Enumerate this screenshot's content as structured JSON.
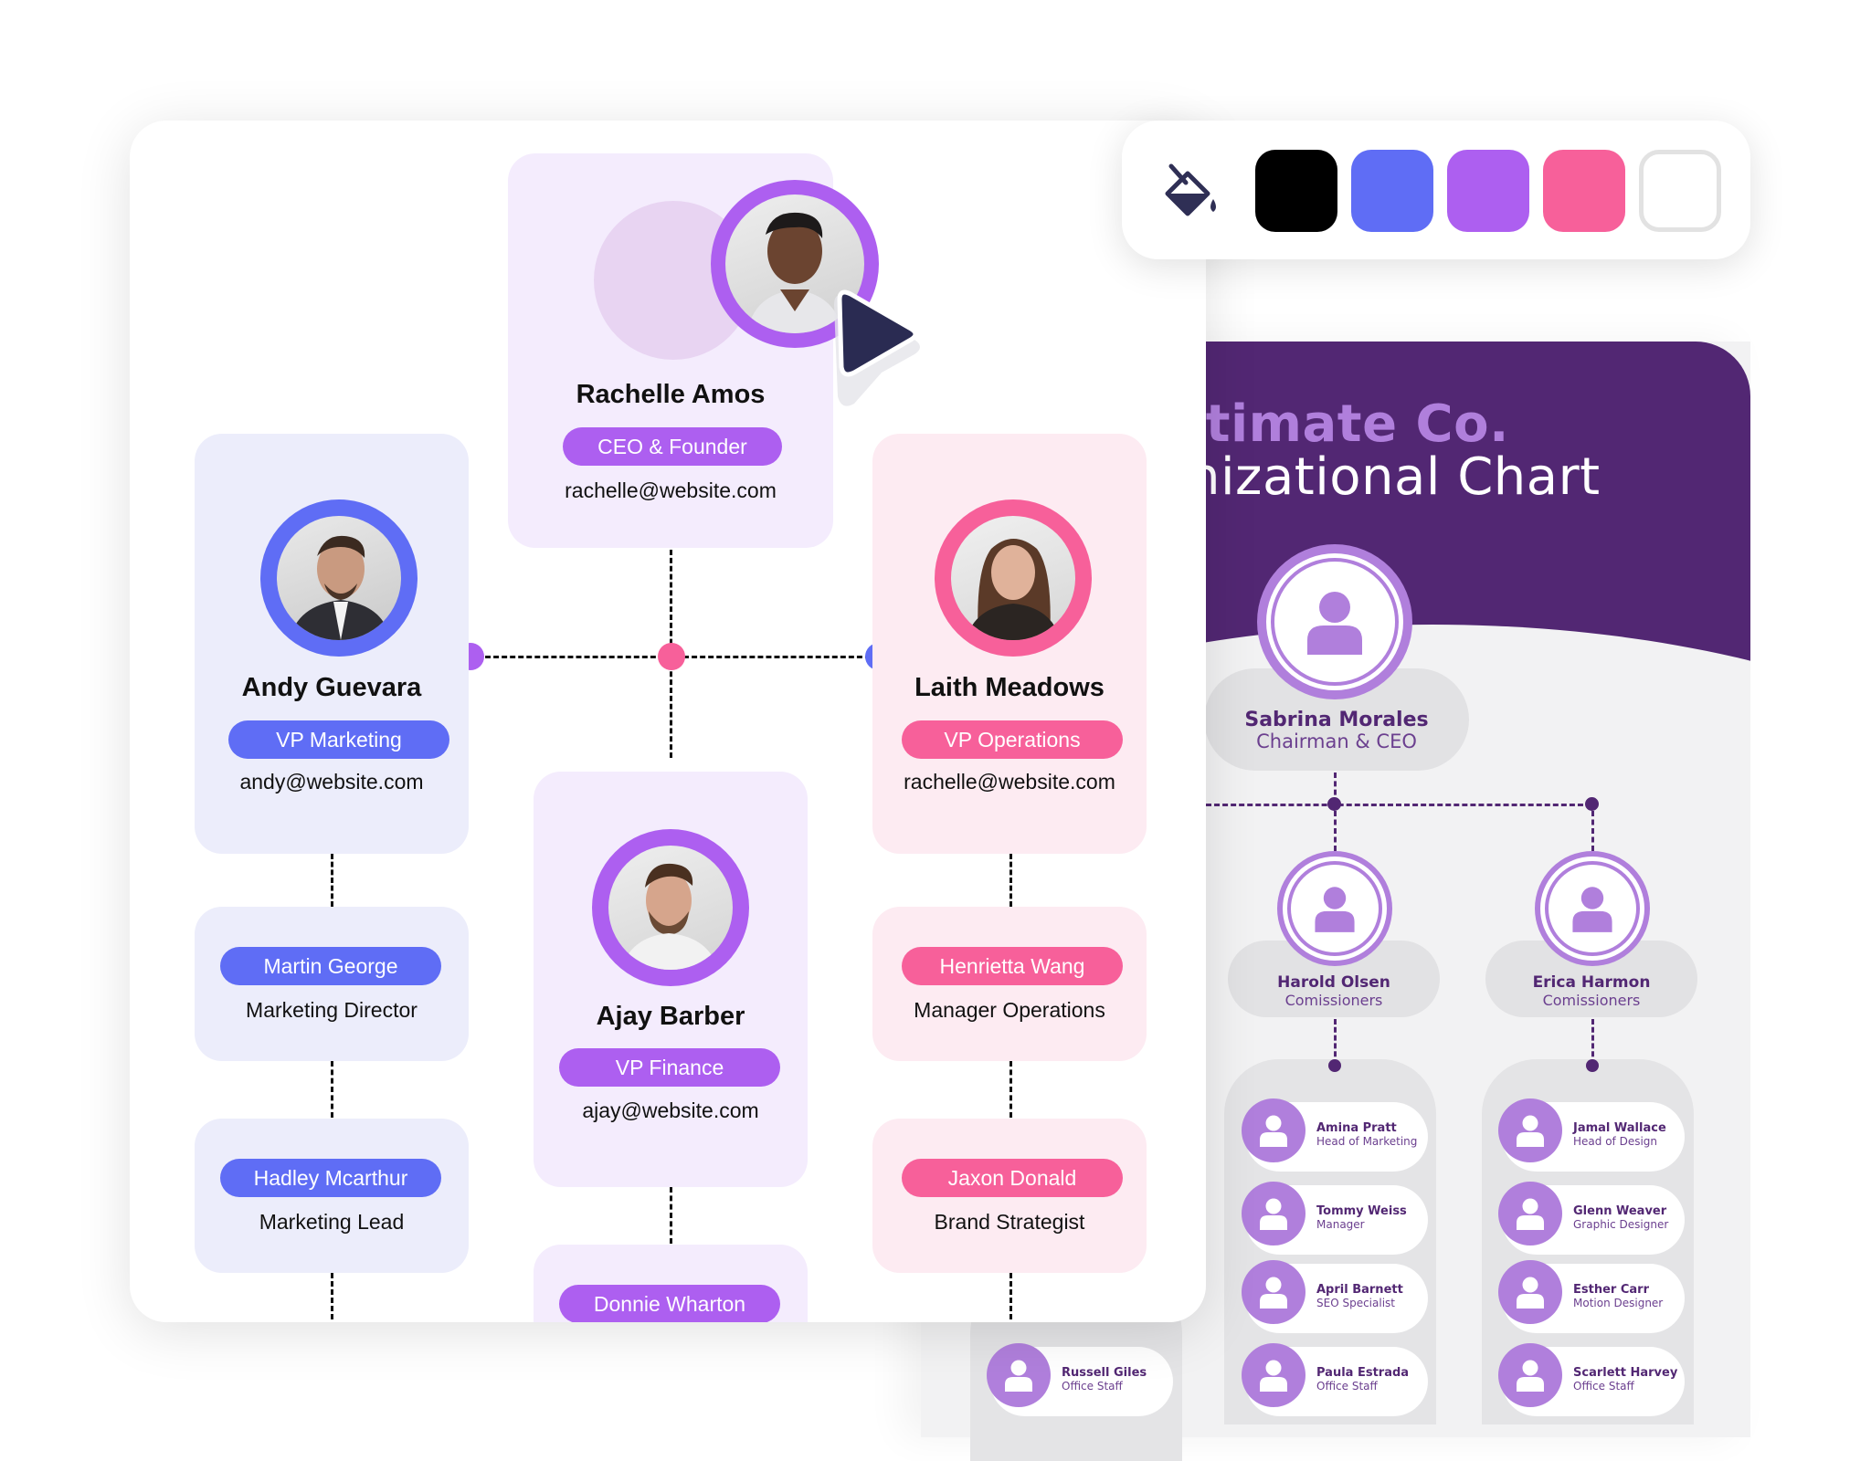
{
  "palette": {
    "icon": "paint-bucket-icon",
    "swatches": [
      {
        "name": "black",
        "color": "#000000"
      },
      {
        "name": "blue",
        "color": "#5f6df5"
      },
      {
        "name": "purple",
        "color": "#ad5ff0"
      },
      {
        "name": "pink",
        "color": "#f7609a"
      },
      {
        "name": "white",
        "color": "#ffffff"
      }
    ]
  },
  "org_chart": {
    "ceo": {
      "name": "Rachelle Amos",
      "title": "CEO & Founder",
      "email": "rachelle@website.com",
      "accent": "#ad5ff0"
    },
    "vps": [
      {
        "name": "Andy Guevara",
        "title": "VP Marketing",
        "email": "andy@website.com",
        "accent": "#5f6df5"
      },
      {
        "name": "Ajay Barber",
        "title": "VP Finance",
        "email": "ajay@website.com",
        "accent": "#ad5ff0"
      },
      {
        "name": "Laith Meadows",
        "title": "VP Operations",
        "email": "rachelle@website.com",
        "accent": "#f7609a"
      }
    ],
    "reports": {
      "marketing": [
        {
          "name": "Martin George",
          "role": "Marketing Director"
        },
        {
          "name": "Hadley Mcarthur",
          "role": "Marketing Lead"
        }
      ],
      "finance": [
        {
          "name": "Donnie Wharton"
        }
      ],
      "operations": [
        {
          "name": "Henrietta Wang",
          "role": "Manager Operations"
        },
        {
          "name": "Jaxon Donald",
          "role": "Brand Strategist"
        }
      ]
    }
  },
  "template_preview": {
    "title_line1": "Ultimate Co.",
    "title_line2": "Organizational Chart",
    "title_line1_visible": "ltimate Co.",
    "title_line2_visible": "nizational Chart",
    "head": {
      "name": "Sabrina Morales",
      "role": "Chairman & CEO"
    },
    "commissioners": [
      {
        "name": "Harold Olsen",
        "role": "Comissioners"
      },
      {
        "name": "Erica Harmon",
        "role": "Comissioners"
      }
    ],
    "staff_left": [
      {
        "name": "Amina Pratt",
        "role": "Head of Marketing"
      },
      {
        "name": "Tommy Weiss",
        "role": "Manager"
      },
      {
        "name": "April Barnett",
        "role": "SEO Specialist"
      },
      {
        "name": "Paula Estrada",
        "role": "Office Staff"
      }
    ],
    "staff_right": [
      {
        "name": "Jamal Wallace",
        "role": "Head of Design"
      },
      {
        "name": "Glenn Weaver",
        "role": "Graphic Designer"
      },
      {
        "name": "Esther Carr",
        "role": "Motion Designer"
      },
      {
        "name": "Scarlett Harvey",
        "role": "Office Staff"
      }
    ],
    "staff_partial": [
      {
        "name": "Russell Giles",
        "role": "Office Staff"
      }
    ]
  }
}
